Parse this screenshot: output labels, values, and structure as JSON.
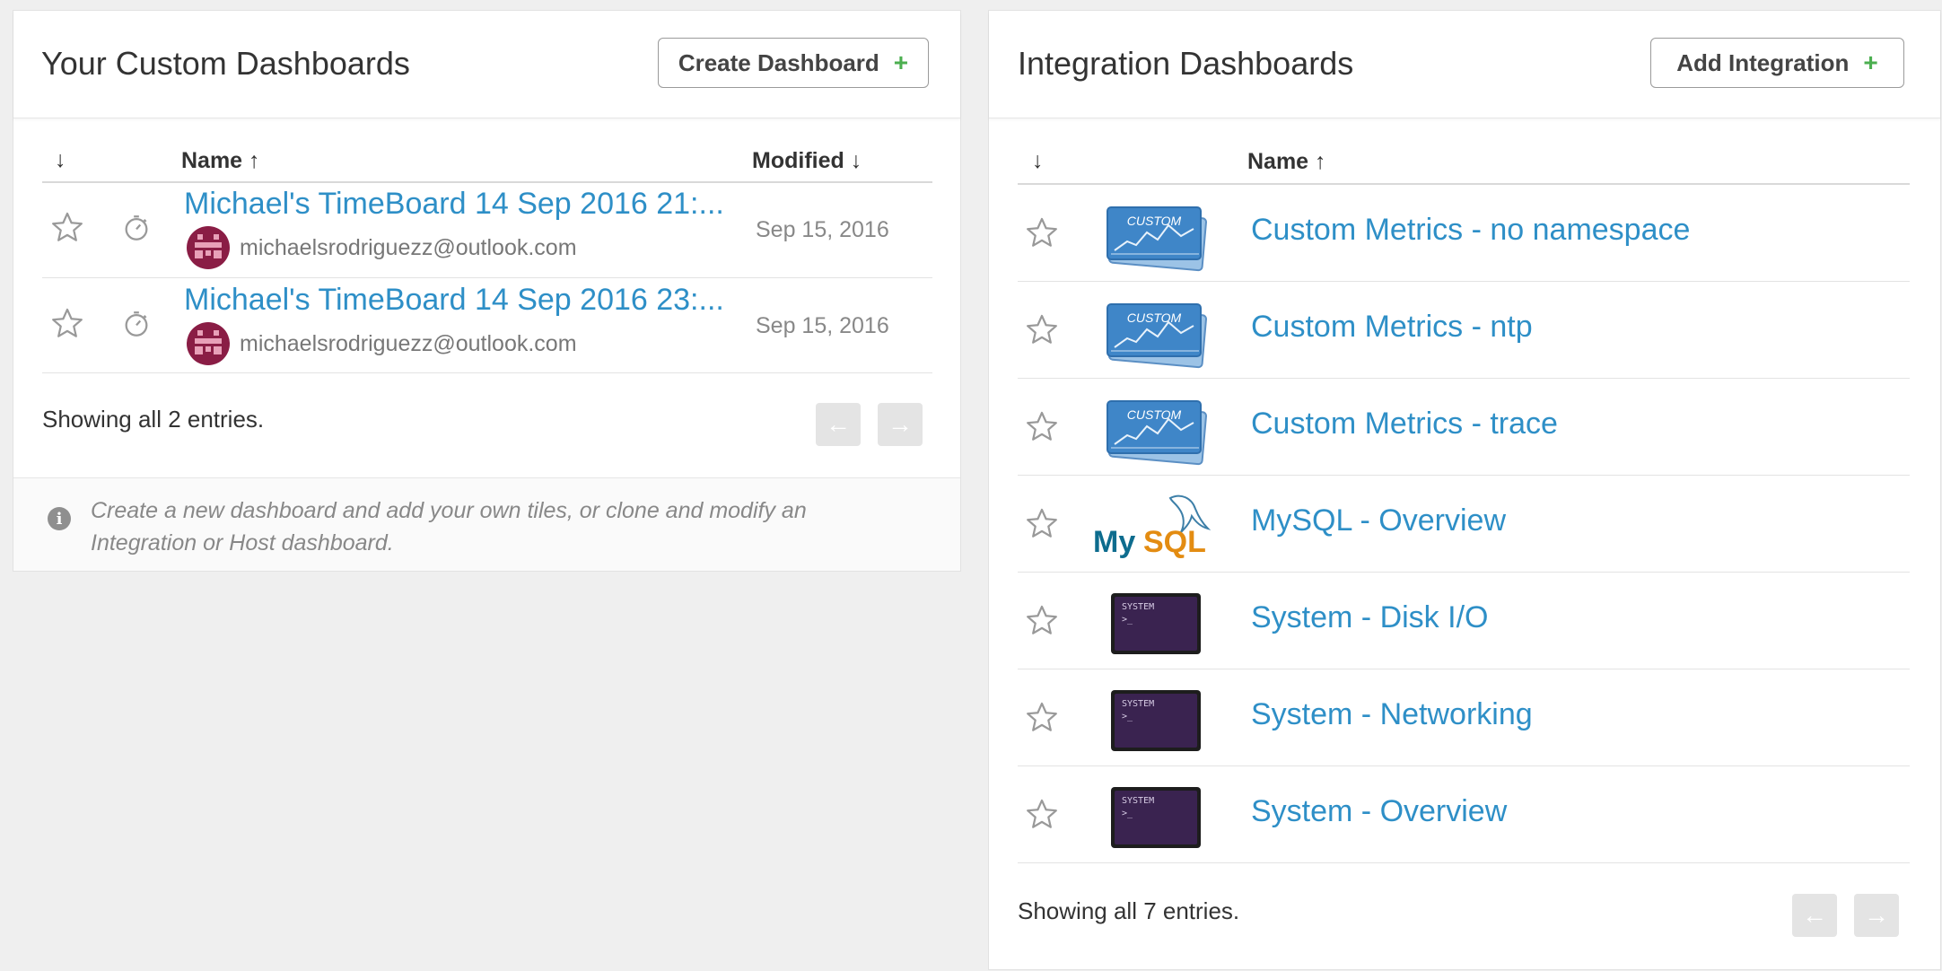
{
  "custom_panel": {
    "title": "Your Custom Dashboards",
    "create_button_label": "Create Dashboard",
    "plus": "+",
    "columns": {
      "sort": "↓",
      "name": "Name ↑",
      "modified": "Modified ↓"
    },
    "rows": [
      {
        "title": "Michael's TimeBoard 14 Sep 2016 21:...",
        "owner": "michaelsrodriguezz@outlook.com",
        "modified": "Sep 15, 2016"
      },
      {
        "title": "Michael's TimeBoard 14 Sep 2016 23:...",
        "owner": "michaelsrodriguezz@outlook.com",
        "modified": "Sep 15, 2016"
      }
    ],
    "entries": "Showing all 2 entries.",
    "prev": "←",
    "next": "→",
    "info_icon": "i",
    "info_text": "Create a new dashboard and add your own tiles, or clone and modify an Integration or Host dashboard."
  },
  "integration_panel": {
    "title": "Integration Dashboards",
    "add_button_label": "Add Integration",
    "plus": "+",
    "columns": {
      "sort": "↓",
      "name": "Name ↑"
    },
    "rows": [
      {
        "name": "Custom Metrics - no namespace",
        "logo": "custom-metrics-logo",
        "logo_text": "CUSTOM"
      },
      {
        "name": "Custom Metrics - ntp",
        "logo": "custom-metrics-logo",
        "logo_text": "CUSTOM"
      },
      {
        "name": "Custom Metrics - trace",
        "logo": "custom-metrics-logo",
        "logo_text": "CUSTOM"
      },
      {
        "name": "MySQL - Overview",
        "logo": "mysql-logo",
        "logo_text": "MySQL"
      },
      {
        "name": "System - Disk I/O",
        "logo": "system-logo",
        "logo_text": "SYSTEM"
      },
      {
        "name": "System - Networking",
        "logo": "system-logo",
        "logo_text": "SYSTEM"
      },
      {
        "name": "System - Overview",
        "logo": "system-logo",
        "logo_text": "SYSTEM"
      }
    ],
    "entries": "Showing all 7 entries.",
    "prev": "←",
    "next": "→"
  },
  "colors": {
    "link": "#2e8fc7",
    "plus": "#4caf50",
    "avatar": "#8a1d45",
    "system_logo": "#3a2350",
    "custom_logo": "#3f86c8"
  }
}
